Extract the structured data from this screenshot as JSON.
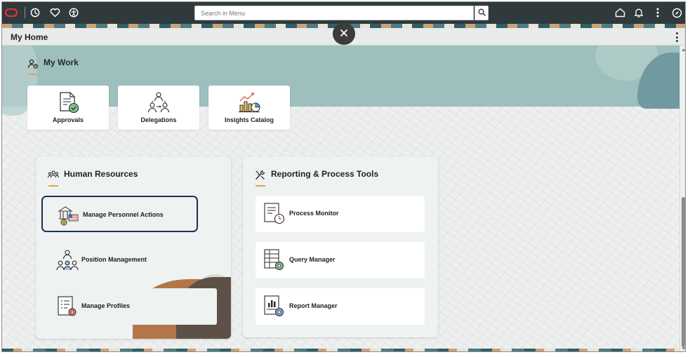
{
  "topbar": {
    "icons": [
      "oracle-logo-icon",
      "recent-clock-icon",
      "favorites-heart-icon",
      "accessibility-icon",
      "home-icon",
      "notifications-bell-icon",
      "more-actions-icon",
      "navigator-compass-icon"
    ],
    "search_placeholder": "Search in Menu"
  },
  "header": {
    "title": "My Home"
  },
  "my_work": {
    "title": "My Work",
    "tiles": [
      {
        "label": "Approvals",
        "icon": "approvals-document-check-icon"
      },
      {
        "label": "Delegations",
        "icon": "delegations-people-icon"
      },
      {
        "label": "Insights Catalog",
        "icon": "insights-chart-icon"
      }
    ]
  },
  "human_resources": {
    "title": "Human Resources",
    "items": [
      {
        "label": "Manage Personnel Actions",
        "icon": "personnel-actions-icon",
        "selected": true
      },
      {
        "label": "Position Management",
        "icon": "position-management-icon"
      },
      {
        "label": "Manage Profiles",
        "icon": "manage-profiles-icon"
      }
    ]
  },
  "reporting_tools": {
    "title": "Reporting & Process Tools",
    "items": [
      {
        "label": "Process Monitor",
        "icon": "process-monitor-icon"
      },
      {
        "label": "Query Manager",
        "icon": "query-manager-icon"
      },
      {
        "label": "Report Manager",
        "icon": "report-manager-icon"
      }
    ]
  },
  "colors": {
    "topbar": "#2f3a3d",
    "accent_underline": "#e3a14b",
    "teal_band": "#9dbfbd",
    "selected_border": "#1a3152"
  }
}
